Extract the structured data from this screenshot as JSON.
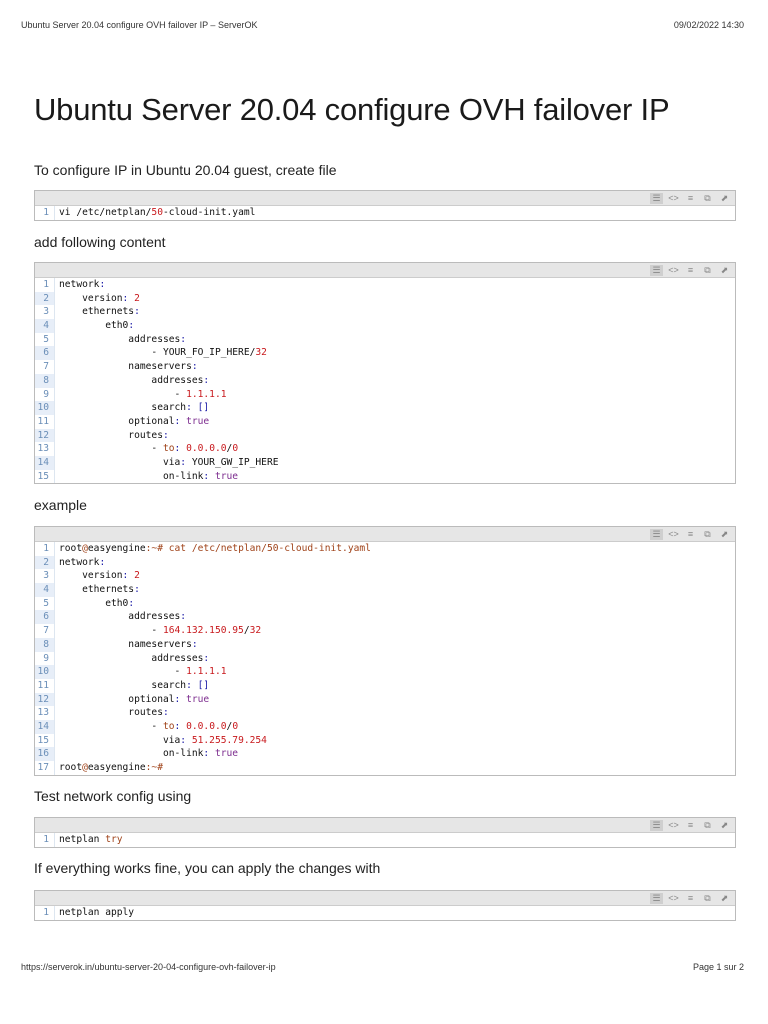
{
  "header": {
    "title": "Ubuntu Server 20.04 configure OVH failover IP – ServerOK",
    "datetime": "09/02/2022 14:30"
  },
  "footer": {
    "url": "https://serverok.in/ubuntu-server-20-04-configure-ovh-failover-ip",
    "page": "Page 1 sur 2"
  },
  "title": "Ubuntu Server 20.04 configure OVH failover IP",
  "paragraphs": [
    "To configure IP in Ubuntu 20.04 guest, create file",
    "add following content",
    "example",
    "Test network config using",
    "If everything works fine, you can apply the changes with"
  ],
  "toolbar_icons": [
    "view-source-icon",
    "code-icon",
    "wrap-icon",
    "copy-icon",
    "popup-icon"
  ],
  "blocks": [
    [
      [
        [
          "vi /etc/netplan/",
          "k"
        ],
        [
          "50",
          "n"
        ],
        [
          "-cloud-init.yaml",
          "k"
        ]
      ]
    ],
    [
      [
        [
          "network",
          "k"
        ],
        [
          ":",
          "c"
        ]
      ],
      [
        [
          "    version",
          "k"
        ],
        [
          ": ",
          "c"
        ],
        [
          "2",
          "n"
        ]
      ],
      [
        [
          "    ethernets",
          "k"
        ],
        [
          ":",
          "c"
        ]
      ],
      [
        [
          "        eth0",
          "k"
        ],
        [
          ":",
          "c"
        ]
      ],
      [
        [
          "            addresses",
          "k"
        ],
        [
          ":",
          "c"
        ]
      ],
      [
        [
          "                - YOUR_FO_IP_HERE/",
          "k"
        ],
        [
          "32",
          "n"
        ]
      ],
      [
        [
          "            nameservers",
          "k"
        ],
        [
          ":",
          "c"
        ]
      ],
      [
        [
          "                addresses",
          "k"
        ],
        [
          ":",
          "c"
        ]
      ],
      [
        [
          "                    - ",
          "k"
        ],
        [
          "1.1.1.1",
          "n"
        ]
      ],
      [
        [
          "                search",
          "k"
        ],
        [
          ": ",
          "c"
        ],
        [
          "[]",
          "c"
        ]
      ],
      [
        [
          "            optional",
          "k"
        ],
        [
          ": ",
          "c"
        ],
        [
          "true",
          "b"
        ]
      ],
      [
        [
          "            routes",
          "k"
        ],
        [
          ":",
          "c"
        ]
      ],
      [
        [
          "                - ",
          "k"
        ],
        [
          "to",
          "s"
        ],
        [
          ": ",
          "c"
        ],
        [
          "0.0.0.0",
          "n"
        ],
        [
          "/",
          "k"
        ],
        [
          "0",
          "n"
        ]
      ],
      [
        [
          "                  via",
          "k"
        ],
        [
          ": ",
          "c"
        ],
        [
          "YOUR_GW_IP_HERE",
          "k"
        ]
      ],
      [
        [
          "                  on-link",
          "k"
        ],
        [
          ": ",
          "c"
        ],
        [
          "true",
          "b"
        ]
      ]
    ],
    [
      [
        [
          "root",
          "k"
        ],
        [
          "@",
          "s"
        ],
        [
          "easyengine",
          "k"
        ],
        [
          ":~# cat /etc/netplan/50-cloud-init.yaml",
          "s"
        ]
      ],
      [
        [
          "network",
          "k"
        ],
        [
          ":",
          "c"
        ]
      ],
      [
        [
          "    version",
          "k"
        ],
        [
          ": ",
          "c"
        ],
        [
          "2",
          "n"
        ]
      ],
      [
        [
          "    ethernets",
          "k"
        ],
        [
          ":",
          "c"
        ]
      ],
      [
        [
          "        eth0",
          "k"
        ],
        [
          ":",
          "c"
        ]
      ],
      [
        [
          "            addresses",
          "k"
        ],
        [
          ":",
          "c"
        ]
      ],
      [
        [
          "                - ",
          "k"
        ],
        [
          "164.132.150.95",
          "n"
        ],
        [
          "/",
          "k"
        ],
        [
          "32",
          "n"
        ]
      ],
      [
        [
          "            nameservers",
          "k"
        ],
        [
          ":",
          "c"
        ]
      ],
      [
        [
          "                addresses",
          "k"
        ],
        [
          ":",
          "c"
        ]
      ],
      [
        [
          "                    - ",
          "k"
        ],
        [
          "1.1.1.1",
          "n"
        ]
      ],
      [
        [
          "                search",
          "k"
        ],
        [
          ": ",
          "c"
        ],
        [
          "[]",
          "c"
        ]
      ],
      [
        [
          "            optional",
          "k"
        ],
        [
          ": ",
          "c"
        ],
        [
          "true",
          "b"
        ]
      ],
      [
        [
          "            routes",
          "k"
        ],
        [
          ":",
          "c"
        ]
      ],
      [
        [
          "                - ",
          "k"
        ],
        [
          "to",
          "s"
        ],
        [
          ": ",
          "c"
        ],
        [
          "0.0.0.0",
          "n"
        ],
        [
          "/",
          "k"
        ],
        [
          "0",
          "n"
        ]
      ],
      [
        [
          "                  via",
          "k"
        ],
        [
          ": ",
          "c"
        ],
        [
          "51.255.79.254",
          "n"
        ]
      ],
      [
        [
          "                  on-link",
          "k"
        ],
        [
          ": ",
          "c"
        ],
        [
          "true",
          "b"
        ]
      ],
      [
        [
          "root",
          "k"
        ],
        [
          "@",
          "s"
        ],
        [
          "easyengine",
          "k"
        ],
        [
          ":~#",
          "s"
        ]
      ]
    ],
    [
      [
        [
          "netplan ",
          "k"
        ],
        [
          "try",
          "s"
        ]
      ]
    ],
    [
      [
        [
          "netplan apply",
          "k"
        ]
      ]
    ]
  ]
}
